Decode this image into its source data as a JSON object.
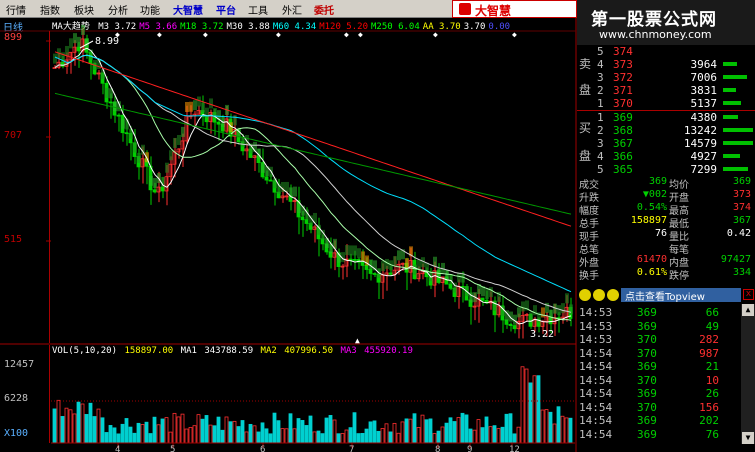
{
  "menu": {
    "items": [
      "行情",
      "指数",
      "板块",
      "分析",
      "功能",
      "大智慧",
      "平台",
      "工具",
      "外汇",
      "委托"
    ]
  },
  "logo": {
    "text": "大智慧"
  },
  "brand": {
    "title": "第一股票公式网",
    "url": "www.chnmoney.com"
  },
  "chart": {
    "timeframe": "日线",
    "indicator_name": "MA大趋势",
    "ma_legend": [
      {
        "label": "M3",
        "value": "3.72",
        "color": "#ffffff"
      },
      {
        "label": "M5",
        "value": "3.66",
        "color": "#ff00ff"
      },
      {
        "label": "M18",
        "value": "3.72",
        "color": "#00ff00"
      },
      {
        "label": "M30",
        "value": "3.88",
        "color": "#ffffff"
      },
      {
        "label": "M60",
        "value": "4.34",
        "color": "#00ffff"
      },
      {
        "label": "M120",
        "value": "5.20",
        "color": "#ff0000"
      },
      {
        "label": "M250",
        "value": "6.04",
        "color": "#00ff00"
      },
      {
        "label": "AA",
        "value": "3.70",
        "color": "#ffff00"
      },
      {
        "label": "",
        "value": "3.70",
        "color": "#ffffff"
      },
      {
        "label": "",
        "value": "0.00",
        "color": "#5050ff"
      }
    ],
    "price_ticks": [
      "899",
      "707",
      "515"
    ],
    "high_marker": "8.99",
    "low_marker": "3.22",
    "x_ticks": [
      "4",
      "5",
      "6",
      "7",
      "8",
      "9",
      "12"
    ],
    "volume_ticks": [
      "12457",
      "6228",
      "X100"
    ],
    "volume_legend": {
      "params": "VOL(5,10,20)",
      "vol": "158897.00",
      "ma1_label": "MA1",
      "ma1": "343788.59",
      "ma2_label": "MA2",
      "ma2": "407996.50",
      "ma3_label": "MA3",
      "ma3": "455920.19"
    }
  },
  "orderbook": {
    "sell_label": [
      "卖",
      "盘"
    ],
    "buy_label": [
      "买",
      "盘"
    ],
    "sell": [
      {
        "level": "5",
        "price": "374",
        "qty": "",
        "bar": 0
      },
      {
        "level": "4",
        "price": "373",
        "qty": "3964",
        "bar": 14
      },
      {
        "level": "3",
        "price": "372",
        "qty": "7006",
        "bar": 24
      },
      {
        "level": "2",
        "price": "371",
        "qty": "3831",
        "bar": 13
      },
      {
        "level": "1",
        "price": "370",
        "qty": "5137",
        "bar": 18
      }
    ],
    "buy": [
      {
        "level": "1",
        "price": "369",
        "qty": "4380",
        "bar": 15
      },
      {
        "level": "2",
        "price": "368",
        "qty": "13242",
        "bar": 30
      },
      {
        "level": "3",
        "price": "367",
        "qty": "14579",
        "bar": 30
      },
      {
        "level": "4",
        "price": "366",
        "qty": "4927",
        "bar": 17
      },
      {
        "level": "5",
        "price": "365",
        "qty": "7299",
        "bar": 25
      }
    ]
  },
  "quote": [
    {
      "k": "成交",
      "v": "369",
      "vc": "green",
      "k2": "均价",
      "v2": "369",
      "v2c": "green"
    },
    {
      "k": "升跌",
      "v": "▼002",
      "vc": "green",
      "k2": "开盘",
      "v2": "373",
      "v2c": "red"
    },
    {
      "k": "幅度",
      "v": "0.54%",
      "vc": "green",
      "k2": "最高",
      "v2": "374",
      "v2c": "red"
    },
    {
      "k": "总手",
      "v": "158897",
      "vc": "yellow",
      "k2": "最低",
      "v2": "367",
      "v2c": "green"
    },
    {
      "k": "现手",
      "v": "76",
      "vc": "white",
      "k2": "量比",
      "v2": "0.42",
      "v2c": "white"
    },
    {
      "k": "总笔",
      "v": "",
      "vc": "white",
      "k2": "每笔",
      "v2": "",
      "v2c": "white"
    },
    {
      "k": "外盘",
      "v": "61470",
      "vc": "red",
      "k2": "内盘",
      "v2": "97427",
      "v2c": "green"
    },
    {
      "k": "换手",
      "v": "0.61%",
      "vc": "yellow",
      "k2": "跌停",
      "v2": "334",
      "v2c": "green"
    }
  ],
  "tools": {
    "link_text": "点击查看Topview",
    "close": "x"
  },
  "ticks": [
    {
      "time": "14:53",
      "price": "369",
      "pc": "green",
      "vol": "66",
      "vc": "green"
    },
    {
      "time": "14:53",
      "price": "369",
      "pc": "green",
      "vol": "49",
      "vc": "green"
    },
    {
      "time": "14:53",
      "price": "370",
      "pc": "green",
      "vol": "282",
      "vc": "red"
    },
    {
      "time": "14:54",
      "price": "370",
      "pc": "green",
      "vol": "987",
      "vc": "red"
    },
    {
      "time": "14:54",
      "price": "369",
      "pc": "green",
      "vol": "21",
      "vc": "green"
    },
    {
      "time": "14:54",
      "price": "370",
      "pc": "green",
      "vol": "10",
      "vc": "red"
    },
    {
      "time": "14:54",
      "price": "369",
      "pc": "green",
      "vol": "26",
      "vc": "green"
    },
    {
      "time": "14:54",
      "price": "370",
      "pc": "green",
      "vol": "156",
      "vc": "red"
    },
    {
      "time": "14:54",
      "price": "369",
      "pc": "green",
      "vol": "202",
      "vc": "green"
    },
    {
      "time": "14:54",
      "price": "369",
      "pc": "green",
      "vol": "76",
      "vc": "green"
    }
  ],
  "colors": {
    "up": "#ff3030",
    "down": "#00d000",
    "axis": "#a00000",
    "ma3": "#ffffff",
    "ma60": "#00ffff",
    "ma120": "#ff0000",
    "ma250": "#00aa00"
  }
}
